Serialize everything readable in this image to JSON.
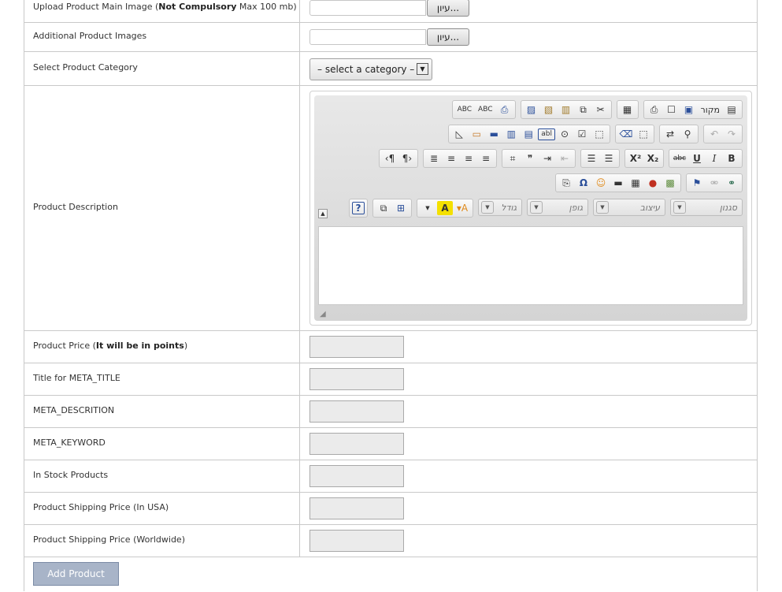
{
  "form": {
    "browse_label": "עיון...",
    "rows": {
      "main_image": {
        "label_pre": "Upload Product Main Image (",
        "label_bold": "Not Compulsory",
        "label_post": " Max 100 mb)"
      },
      "additional_images": {
        "label": "Additional Product Images"
      },
      "category": {
        "label": "Select Product Category",
        "selected": "– select a category –"
      },
      "description": {
        "label": "Product Description"
      },
      "price": {
        "label_pre": "Product Price (",
        "label_bold": "It will be in points",
        "label_post": ")"
      },
      "meta_title": {
        "label": "Title for META_TITLE"
      },
      "meta_description": {
        "label": "META_DESCRITION"
      },
      "meta_keyword": {
        "label": "META_KEYWORD"
      },
      "in_stock": {
        "label": "In Stock Products"
      },
      "shipping_usa": {
        "label": "Product Shipping Price (In USA)"
      },
      "shipping_world": {
        "label": "Product Shipping Price (Worldwide)"
      }
    },
    "submit_label": "Add Product"
  },
  "editor": {
    "source_label": "מקור",
    "combo_style": "סגנון",
    "combo_format": "עיצוב",
    "combo_font": "גופן",
    "combo_size": "גודל",
    "spell_label_1": "ABC",
    "spell_label_2": "ABC",
    "strike_label": "abc",
    "bold_label": "B",
    "italic_label": "I",
    "underline_label": "U",
    "sub_label": "X₂",
    "sup_label": "X²",
    "textfield_label": "abl",
    "color_label": "A",
    "help_label": "?",
    "omega_label": "Ω"
  }
}
